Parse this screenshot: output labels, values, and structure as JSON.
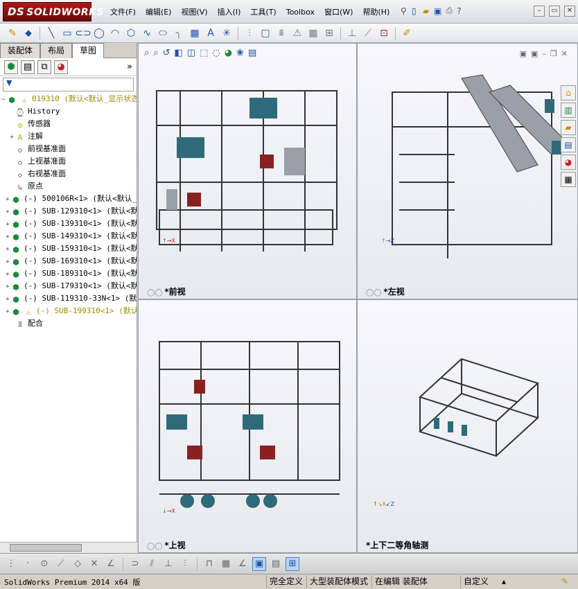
{
  "app": {
    "logo": "SOLIDWORKS",
    "logo_ds": "DS"
  },
  "menu": [
    "文件(F)",
    "编辑(E)",
    "视图(V)",
    "插入(I)",
    "工具(T)",
    "Toolbox",
    "窗口(W)",
    "帮助(H)"
  ],
  "tabs": [
    {
      "label": "装配体"
    },
    {
      "label": "布局"
    },
    {
      "label": "草图"
    }
  ],
  "tree": {
    "root": {
      "name": "019310",
      "config": "(默认<默认_显示状态"
    },
    "items": [
      {
        "label": "History",
        "icon": "history-icon"
      },
      {
        "label": "传感器",
        "icon": "sensor-icon"
      },
      {
        "label": "注解",
        "icon": "annotation-icon",
        "expand": "+"
      },
      {
        "label": "前视基准面",
        "icon": "plane-icon"
      },
      {
        "label": "上视基准面",
        "icon": "plane-icon"
      },
      {
        "label": "右视基准面",
        "icon": "plane-icon"
      },
      {
        "label": "原点",
        "icon": "origin-icon"
      },
      {
        "label": "(-) 500106R<1> (默认<默认_",
        "icon": "part-icon",
        "expand": "+"
      },
      {
        "label": "(-) SUB-129310<1> (默认<默",
        "icon": "part-icon",
        "expand": "+"
      },
      {
        "label": "(-) SUB-139310<1> (默认<默",
        "icon": "part-icon",
        "expand": "+"
      },
      {
        "label": "(-) SUB-149310<1> (默认<默",
        "icon": "part-icon",
        "expand": "+"
      },
      {
        "label": "(-) SUB-159310<1> (默认<默",
        "icon": "part-icon",
        "expand": "+"
      },
      {
        "label": "(-) SUB-169310<1> (默认<默",
        "icon": "part-icon",
        "expand": "+"
      },
      {
        "label": "(-) SUB-189310<1> (默认<默",
        "icon": "part-icon",
        "expand": "+"
      },
      {
        "label": "(-) SUB-179310<1> (默认<默",
        "icon": "part-icon",
        "expand": "+"
      },
      {
        "label": "(-) SUB-119310-33N<1> (默认",
        "icon": "part-icon",
        "expand": "+"
      },
      {
        "label": "(-) SUB-199310<1> (默认<",
        "icon": "warning-part-icon",
        "expand": "+"
      },
      {
        "label": "配合",
        "icon": "mates-icon"
      }
    ]
  },
  "viewports": [
    {
      "name": "前视",
      "prefix": "*"
    },
    {
      "name": "左视",
      "prefix": "*"
    },
    {
      "name": "上视",
      "prefix": "*"
    },
    {
      "name": "上下二等角轴测",
      "prefix": "*"
    }
  ],
  "status": {
    "left": "SolidWorks Premium 2014 x64 版",
    "f1": "完全定义",
    "f2": "大型装配体模式",
    "f3": "在编辑 装配体",
    "f4": "自定义"
  }
}
